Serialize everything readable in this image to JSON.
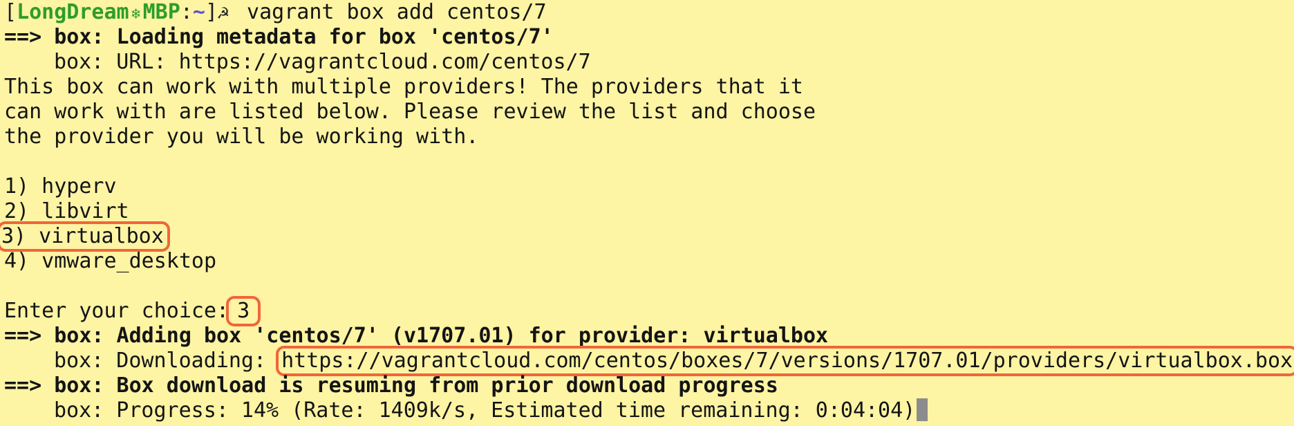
{
  "prompt": {
    "open_bracket": "[",
    "user": "LongDream",
    "host_symbol": "❄",
    "host": "MBP",
    "sep": ":",
    "cwd": "~",
    "close_bracket": "]",
    "symbol": "☭",
    "command": " vagrant box add centos/7"
  },
  "lines": {
    "l1": "==> box: Loading metadata for box 'centos/7'",
    "l2": "box: URL: https://vagrantcloud.com/centos/7",
    "l3": "This box can work with multiple providers! The providers that it",
    "l4": "can work with are listed below. Please review the list and choose",
    "l5": "the provider you will be working with.",
    "opt1": "1) hyperv",
    "opt2": "2) libvirt",
    "opt3": "3) virtualbox",
    "opt4": "4) vmware_desktop",
    "choice_label": "Enter your choice:",
    "choice_value": "3",
    "l6": "==> box: Adding box 'centos/7' (v1707.01) for provider: virtualbox",
    "l7_label": "box: Downloading: ",
    "l7_url": "https://vagrantcloud.com/centos/boxes/7/versions/1707.01/providers/virtualbox.box",
    "l8": "==> box: Box download is resuming from prior download progress",
    "l9": "box: Progress: 14% (Rate: 1409k/s, Estimated time remaining: 0:04:04)"
  },
  "colors": {
    "background": "#fdf4a4",
    "highlight": "#f0663a",
    "prompt_host": "#2e9d2a",
    "prompt_cwd": "#5a53c9"
  }
}
